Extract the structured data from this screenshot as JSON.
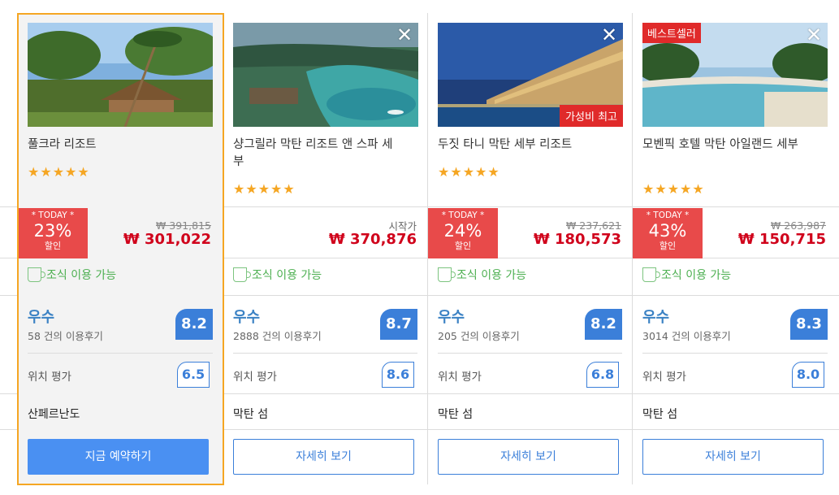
{
  "hotels": [
    {
      "name": "풀크라 리조트",
      "stars": "★★★★★",
      "today": {
        "label": "* TODAY *",
        "percent": "23%",
        "word": "할인"
      },
      "original_price": "₩ 391,815",
      "price": "₩ 301,022",
      "breakfast": "조식 이용 가능",
      "rating_word": "우수",
      "reviews": "58 건의 이용후기",
      "score": "8.2",
      "location_label": "위치 평가",
      "location_score": "6.5",
      "area": "산페르난도",
      "button": "지금 예약하기",
      "selected": true
    },
    {
      "name": "샹그릴라 막탄 리조트 앤 스파 세부",
      "stars": "★★★★★",
      "from_label": "시작가",
      "price": "₩ 370,876",
      "breakfast": "조식 이용 가능",
      "rating_word": "우수",
      "reviews": "2888 건의 이용후기",
      "score": "8.7",
      "location_label": "위치 평가",
      "location_score": "8.6",
      "area": "막탄 섬",
      "button": "자세히 보기",
      "close_icon": "✕"
    },
    {
      "name": "두짓 타니 막탄 세부 리조트",
      "stars": "★★★★★",
      "today": {
        "label": "* TODAY *",
        "percent": "24%",
        "word": "할인"
      },
      "original_price": "₩ 237,621",
      "price": "₩ 180,573",
      "breakfast": "조식 이용 가능",
      "rating_word": "우수",
      "reviews": "205 건의 이용후기",
      "score": "8.2",
      "location_label": "위치 평가",
      "location_score": "6.8",
      "area": "막탄 섬",
      "button": "자세히 보기",
      "close_icon": "✕",
      "value_badge": "가성비 최고"
    },
    {
      "name": "모벤픽 호텔 막탄 아일랜드 세부",
      "stars": "★★★★★",
      "today": {
        "label": "* TODAY *",
        "percent": "43%",
        "word": "할인"
      },
      "original_price": "₩ 263,987",
      "price": "₩ 150,715",
      "breakfast": "조식 이용 가능",
      "rating_word": "우수",
      "reviews": "3014 건의 이용후기",
      "score": "8.3",
      "location_label": "위치 평가",
      "location_score": "8.0",
      "area": "막탄 섬",
      "button": "자세히 보기",
      "close_icon": "✕",
      "best_badge": "베스트셀러"
    }
  ],
  "colors": {
    "accent_blue": "#3b7fd9",
    "sale_red": "#d0021b",
    "today_red": "#e84a4a",
    "selected_border": "#f5a623",
    "breakfast_green": "#4caf50"
  }
}
